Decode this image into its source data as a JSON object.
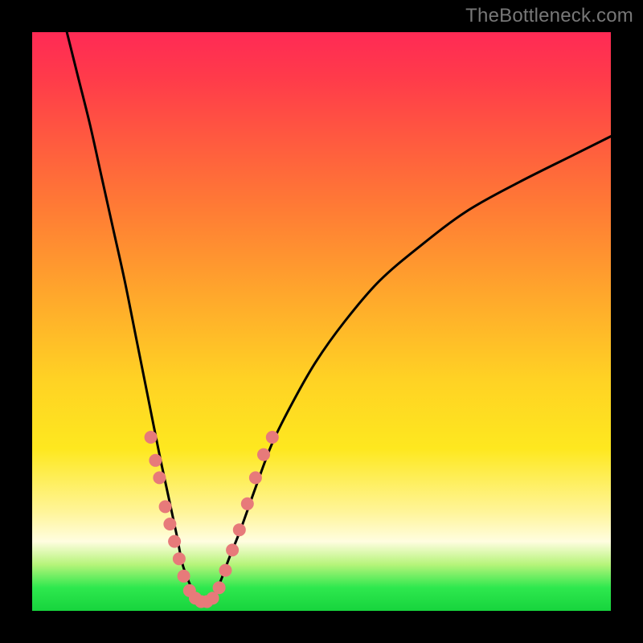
{
  "watermark": "TheBottleneck.com",
  "chart_data": {
    "type": "line",
    "title": "",
    "xlabel": "",
    "ylabel": "",
    "xlim": [
      0,
      100
    ],
    "ylim": [
      0,
      100
    ],
    "grid": false,
    "legend": false,
    "series": [
      {
        "name": "left-branch",
        "x": [
          6,
          8,
          10,
          12,
          14,
          16,
          18,
          20,
          22,
          23.5,
          25,
          26,
          27.5,
          28.5
        ],
        "y": [
          100,
          92,
          84,
          75,
          66,
          57,
          47,
          37,
          27,
          20,
          13,
          8,
          4,
          2
        ]
      },
      {
        "name": "right-branch",
        "x": [
          31,
          32.5,
          34,
          36,
          38.5,
          41.5,
          45,
          49,
          54,
          60,
          67,
          75,
          84,
          94,
          100
        ],
        "y": [
          2,
          5,
          9,
          14,
          21,
          29,
          36,
          43,
          50,
          57,
          63,
          69,
          74,
          79,
          82
        ]
      }
    ],
    "scatter": {
      "name": "highlight-dots",
      "points": [
        {
          "x": 20.5,
          "y": 30
        },
        {
          "x": 21.3,
          "y": 26
        },
        {
          "x": 22.0,
          "y": 23
        },
        {
          "x": 23.0,
          "y": 18
        },
        {
          "x": 23.8,
          "y": 15
        },
        {
          "x": 24.6,
          "y": 12
        },
        {
          "x": 25.4,
          "y": 9
        },
        {
          "x": 26.2,
          "y": 6
        },
        {
          "x": 27.2,
          "y": 3.5
        },
        {
          "x": 28.2,
          "y": 2.2
        },
        {
          "x": 29.2,
          "y": 1.6
        },
        {
          "x": 30.2,
          "y": 1.6
        },
        {
          "x": 31.2,
          "y": 2.2
        },
        {
          "x": 32.3,
          "y": 4
        },
        {
          "x": 33.4,
          "y": 7
        },
        {
          "x": 34.6,
          "y": 10.5
        },
        {
          "x": 35.8,
          "y": 14
        },
        {
          "x": 37.2,
          "y": 18.5
        },
        {
          "x": 38.6,
          "y": 23
        },
        {
          "x": 40.0,
          "y": 27
        },
        {
          "x": 41.5,
          "y": 30
        }
      ]
    },
    "gradient_stops": [
      {
        "pos": 0,
        "color": "#ff2a55"
      },
      {
        "pos": 18,
        "color": "#ff5840"
      },
      {
        "pos": 45,
        "color": "#ffa62c"
      },
      {
        "pos": 72,
        "color": "#fee81f"
      },
      {
        "pos": 88,
        "color": "#fffde0"
      },
      {
        "pos": 96,
        "color": "#2ee84e"
      },
      {
        "pos": 100,
        "color": "#17d43d"
      }
    ]
  }
}
